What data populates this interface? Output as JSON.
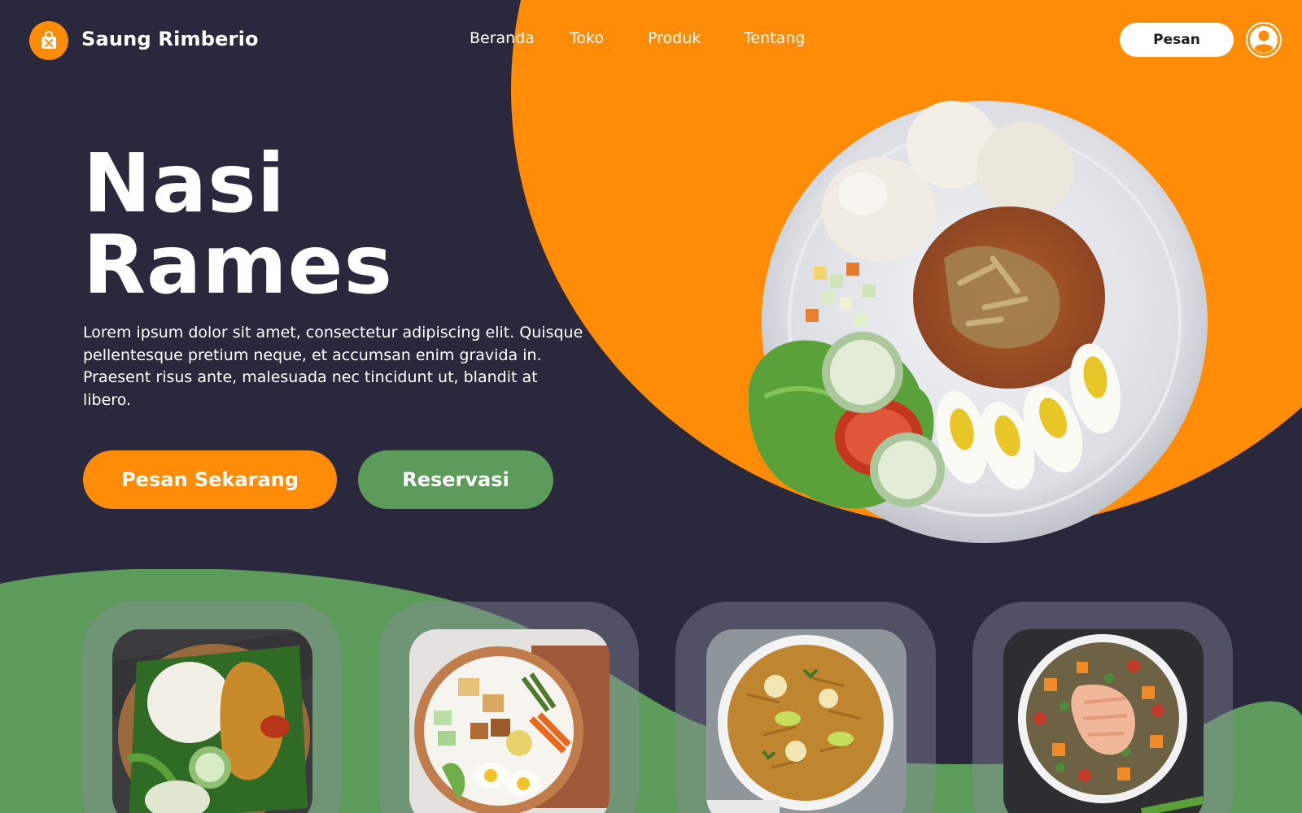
{
  "header": {
    "brand": "Saung Rimberio",
    "logo_icon": "shopping-bag-utensils-icon",
    "nav": [
      {
        "label": "Beranda"
      },
      {
        "label": "Toko"
      },
      {
        "label": "Produk"
      },
      {
        "label": "Tentang"
      }
    ],
    "order_button": "Pesan",
    "profile_icon": "user-icon"
  },
  "hero": {
    "title_line1": "Nasi",
    "title_line2": "Rames",
    "description": "Lorem ipsum dolor sit amet, consectetur adipiscing elit. Quisque pellentesque pretium neque, et accumsan enim gravida in. Praesent risus ante, malesuada nec tincidunt ut, blandit at libero.",
    "primary_button": "Pesan Sekarang",
    "secondary_button": "Reservasi",
    "image": "nasi-rames-plate-photo"
  },
  "cards": [
    {
      "image": "nasi-ayam-banana-leaf-photo"
    },
    {
      "image": "gado-gado-bowl-photo"
    },
    {
      "image": "nasi-goreng-bowl-photo"
    },
    {
      "image": "salmon-salad-bowl-photo"
    }
  ],
  "colors": {
    "background": "#29283d",
    "accent_orange": "#fe8c07",
    "accent_green": "#5c9b5a",
    "text": "#ffffff"
  }
}
